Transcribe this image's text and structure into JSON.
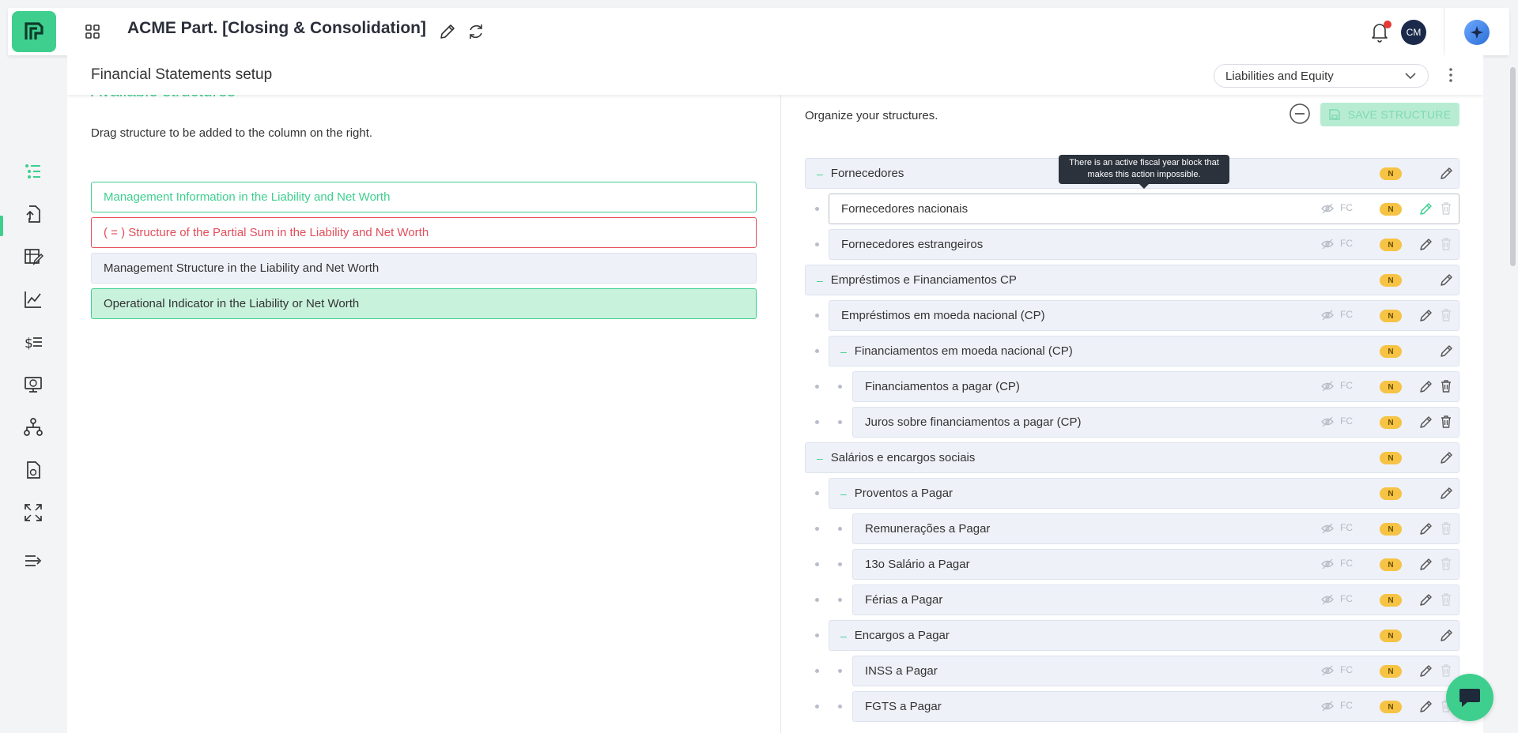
{
  "app": {
    "title": "ACME Part. [Closing & Consolidation]",
    "avatar_initials": "CM",
    "accent_color": "#3ecf8e"
  },
  "page": {
    "title": "Financial Statements setup",
    "structure_select": "Liabilities and Equity"
  },
  "left": {
    "heading": "Available structures",
    "hint": "Drag structure to be added to the column on the right.",
    "items": [
      {
        "label": "Management Information in the Liability and Net Worth",
        "style": "green-outline"
      },
      {
        "label": "( = ) Structure of the Partial Sum in the Liability and Net Worth",
        "style": "red-outline"
      },
      {
        "label": "Management Structure in the Liability and Net Worth",
        "style": "gray-fill"
      },
      {
        "label": "Operational Indicator in the Liability or Net Worth",
        "style": "green-fill"
      }
    ]
  },
  "right": {
    "hint": "Organize your structures.",
    "save_label": "SAVE STRUCTURE",
    "tooltip": "There is an active fiscal year block that makes this action impossible.",
    "badge": "N",
    "fc_label": "FC",
    "toggle_symbol": "–",
    "rows": [
      {
        "label": "Fornecedores",
        "level": 0,
        "group": true
      },
      {
        "label": "Fornecedores nacionais",
        "level": 1,
        "group": false,
        "highlight": true
      },
      {
        "label": "Fornecedores estrangeiros",
        "level": 1,
        "group": false
      },
      {
        "label": "Empréstimos e Financiamentos CP",
        "level": 0,
        "group": true
      },
      {
        "label": "Empréstimos em moeda nacional (CP)",
        "level": 1,
        "group": false
      },
      {
        "label": "Financiamentos em moeda nacional (CP)",
        "level": 1,
        "group": true
      },
      {
        "label": "Financiamentos a pagar (CP)",
        "level": 2,
        "group": false,
        "trash_active": true
      },
      {
        "label": "Juros sobre financiamentos a pagar (CP)",
        "level": 2,
        "group": false,
        "trash_active": true
      },
      {
        "label": "Salários e encargos sociais",
        "level": 0,
        "group": true
      },
      {
        "label": "Proventos a Pagar",
        "level": 1,
        "group": true
      },
      {
        "label": "Remunerações a Pagar",
        "level": 2,
        "group": false
      },
      {
        "label": "13o Salário a Pagar",
        "level": 2,
        "group": false
      },
      {
        "label": "Férias a Pagar",
        "level": 2,
        "group": false
      },
      {
        "label": "Encargos a Pagar",
        "level": 1,
        "group": true
      },
      {
        "label": "INSS a Pagar",
        "level": 2,
        "group": false
      },
      {
        "label": "FGTS a Pagar",
        "level": 2,
        "group": false
      }
    ]
  },
  "sidebar": {
    "items": [
      {
        "icon": "list-tree-icon",
        "active": true
      },
      {
        "icon": "file-upload-icon"
      },
      {
        "icon": "spreadsheet-edit-icon"
      },
      {
        "icon": "line-chart-icon"
      },
      {
        "icon": "dollar-list-icon"
      },
      {
        "icon": "monitor-dollar-icon"
      },
      {
        "icon": "hierarchy-icon"
      },
      {
        "icon": "document-chart-icon"
      },
      {
        "icon": "expand-arrows-icon"
      },
      {
        "icon": "collapse-menu-icon"
      }
    ]
  }
}
